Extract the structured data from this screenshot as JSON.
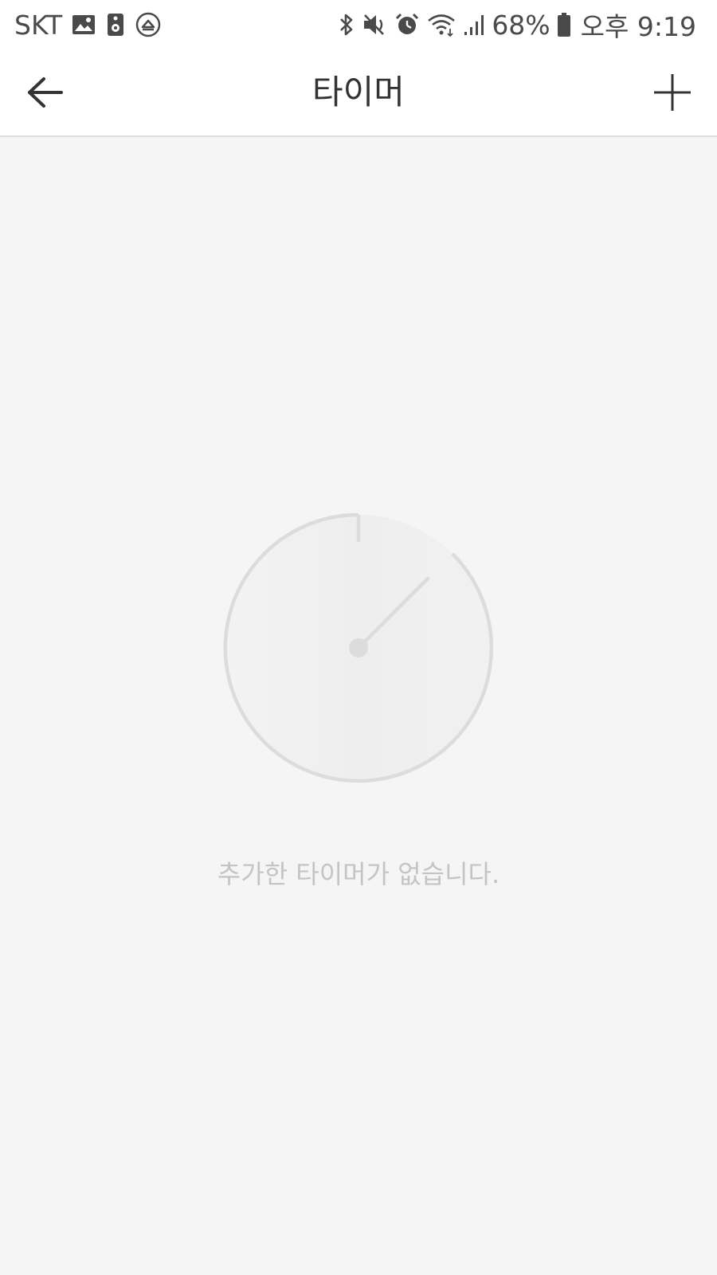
{
  "status_bar": {
    "carrier": "SKT",
    "battery": "68%",
    "time": "오후 9:19",
    "left_icons": [
      "image-icon",
      "speaker-icon",
      "cast-icon"
    ],
    "right_icons": [
      "bluetooth-icon",
      "mute-icon",
      "alarm-icon",
      "wifi-icon",
      "signal-icon",
      "battery-icon"
    ]
  },
  "header": {
    "title": "타이머",
    "back_icon": "arrow-left-icon",
    "add_icon": "plus-icon"
  },
  "empty_state": {
    "icon": "timer-dial-icon",
    "message": "추가한 타이머가 없습니다."
  },
  "colors": {
    "background": "#f5f5f5",
    "header_background": "#ffffff",
    "title_text": "#333333",
    "empty_text": "#c4c4c4",
    "illustration_stroke": "#dcdcdc"
  }
}
